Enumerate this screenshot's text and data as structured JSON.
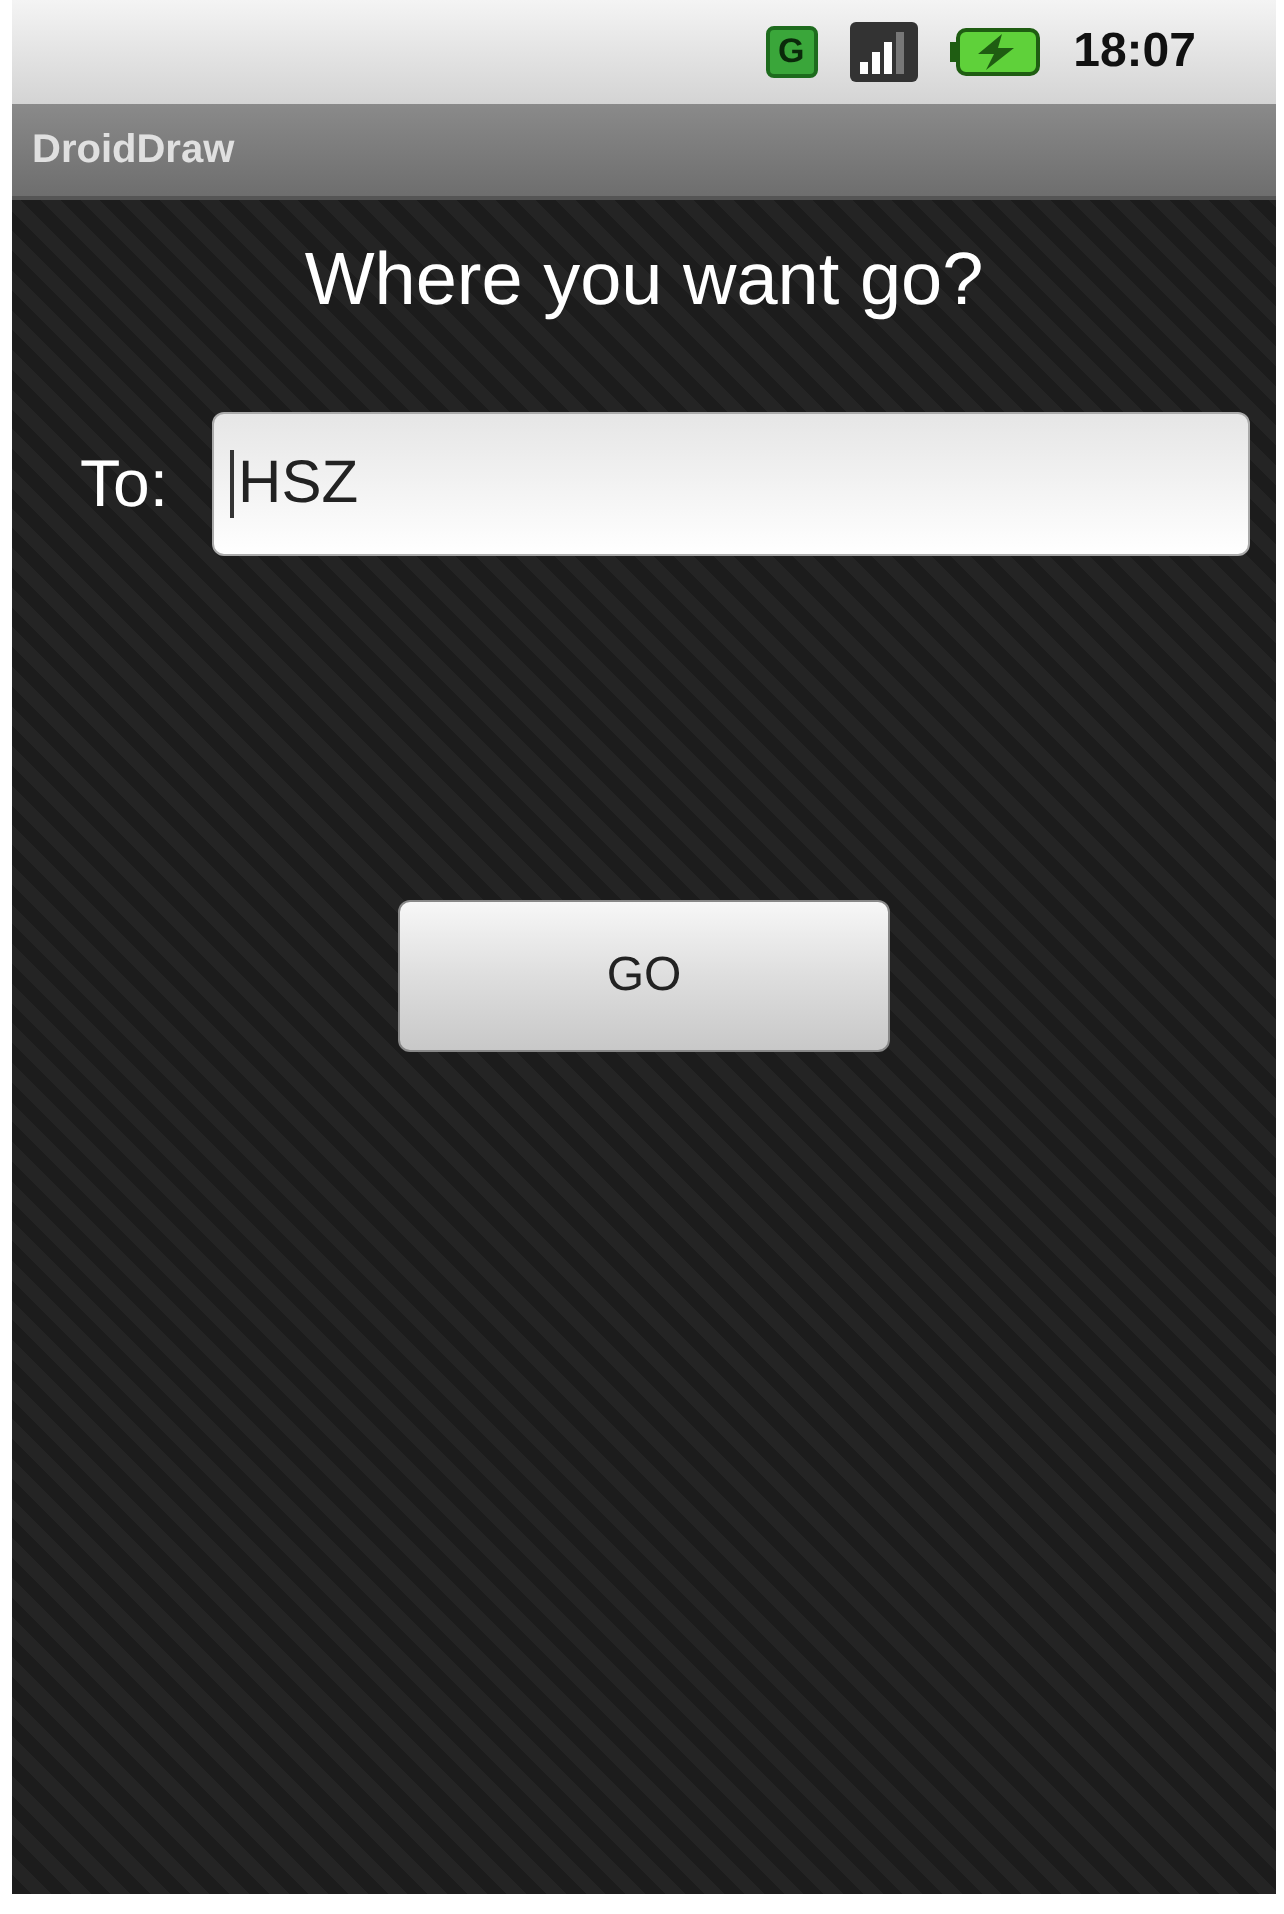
{
  "status_bar": {
    "time": "18:07",
    "network_letter": "G"
  },
  "app_bar": {
    "title": "DroidDraw"
  },
  "heading": "Where you want go?",
  "destination_field": {
    "label": "To:",
    "value": "HSZ",
    "focused": true
  },
  "go_button": {
    "label": "GO"
  }
}
